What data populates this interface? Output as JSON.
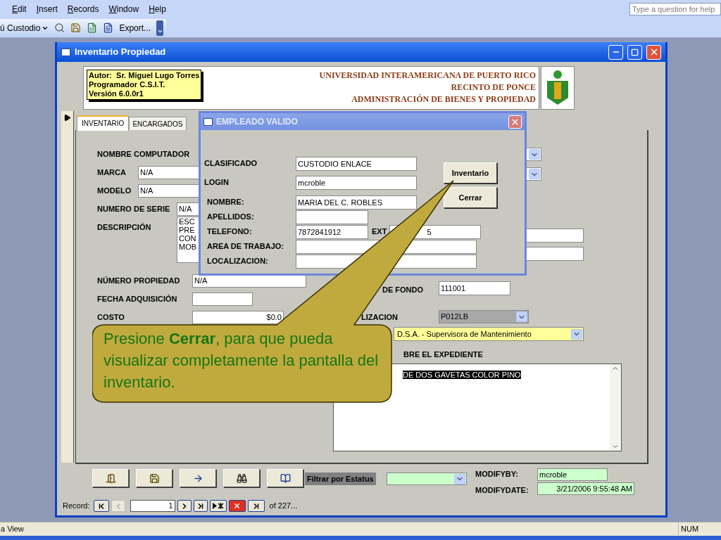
{
  "menu_bar": {
    "items": [
      "Edit",
      "Insert",
      "Records",
      "Window",
      "Help"
    ],
    "help_box": {
      "placeholder": "Type a question for help"
    }
  },
  "toolbar": {
    "menu": "ú Custodio",
    "export": "Export..."
  },
  "window": {
    "title": "Inventario Propiedad"
  },
  "header": {
    "author_lines": [
      "Autor:  Sr. Miguel Lugo Torres",
      "Programador C.S.I.T.",
      "Versión 6.0.0r1"
    ],
    "institution_lines": [
      "UNIVERSIDAD INTERAMERICANA DE PUERTO RICO",
      "RECINTO DE PONCE",
      "ADMINISTRACIÓN DE BIENES Y PROPIEDAD"
    ]
  },
  "tabs": [
    {
      "label": "INVENTARIO",
      "selected": true
    },
    {
      "label": "ENCARGADOS",
      "selected": false
    }
  ],
  "form": {
    "fields": [
      {
        "label": "NOMBRE COMPUTADOR",
        "kind": "label"
      },
      {
        "label": "MARCA",
        "kind": "text",
        "value": "N/A"
      },
      {
        "label": "MODELO",
        "kind": "text",
        "value": "N/A"
      },
      {
        "label": "NUMERO DE SERIE",
        "kind": "text",
        "value": "N/A"
      },
      {
        "label": "DESCRIPCIÓN",
        "kind": "memo",
        "lines": [
          "ESC",
          "PRE",
          "CON",
          "MOB"
        ]
      },
      {
        "label": "NÚMERO PROPIEDAD",
        "kind": "text",
        "value": "N/A"
      },
      {
        "label": "FECHA ADQUISICIÓN",
        "kind": "text"
      },
      {
        "label": "COSTO",
        "kind": "amount",
        "value": "$0.0"
      }
    ],
    "fund": {
      "label": "DE FONDO",
      "value": "111001"
    },
    "location": {
      "label": "LIZACION",
      "value": "P012LB"
    },
    "supervisor": {
      "value": "D.S.A. - Supervisora de Mantenimiento"
    },
    "notes": {
      "label": "BRE EL EXPEDIENTE",
      "text": "DE DOS GAVETAS COLOR PINO"
    }
  },
  "dialog": {
    "title": "EMPLEADO VALIDO",
    "fields": [
      {
        "label": "CLASIFICADO",
        "value": "CUSTODIO ENLACE"
      },
      {
        "label": "LOGIN",
        "value": "mcroble"
      },
      {
        "label": "NOMBRE:",
        "value": "MARIA DEL C. ROBLES"
      },
      {
        "label": "APELLIDOS:"
      },
      {
        "label": "TELEFONO:",
        "value": "7872841912"
      },
      {
        "label": "AREA DE TRABAJO:"
      },
      {
        "label": "LOCALIZACION:"
      }
    ],
    "ext": {
      "label": "EXT",
      "value": "5"
    },
    "buttons": [
      "Inventario",
      "Cerrar"
    ]
  },
  "callout": {
    "text": "Presione **Cerrar**, para que pueda visualizar completamente la pantalla del inventario."
  },
  "footer": {
    "filter_label": "Filtrar por Estatus",
    "modify_by": {
      "label": "MODIFYBY:",
      "value": "mcroble"
    },
    "modify_date": {
      "label": "MODIFYDATE:",
      "value": "3/21/2006 9:55:48 AM"
    }
  },
  "record_nav": {
    "label": "Record:",
    "current": "1",
    "total": "of 227..."
  },
  "status_bar": {
    "left": "a View",
    "indicator": "NUM"
  }
}
